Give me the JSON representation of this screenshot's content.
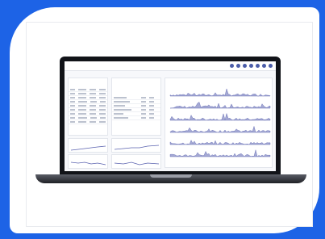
{
  "colors": {
    "background": "#1d63e6",
    "card": "#ffffff",
    "laptop_body": "#111318",
    "screen_bg": "#f7f8fb",
    "chart_series": "#5b63b0",
    "status_dots": "#4a5ca8"
  },
  "icons": [
    "status-dot-icon"
  ],
  "dashboard": {
    "header_title": "",
    "subtitle": "",
    "status_dot_count": 7,
    "panels": [
      {
        "name": "left-table-panel",
        "title": ""
      },
      {
        "name": "mid-table-panel",
        "title": ""
      },
      {
        "name": "charts-panel",
        "title": ""
      },
      {
        "name": "bottom-left-chart-1",
        "title": ""
      },
      {
        "name": "bottom-left-chart-2",
        "title": ""
      },
      {
        "name": "bottom-mid-chart-1",
        "title": ""
      },
      {
        "name": "bottom-mid-chart-2",
        "title": ""
      }
    ],
    "sparkline_rows": 6
  }
}
